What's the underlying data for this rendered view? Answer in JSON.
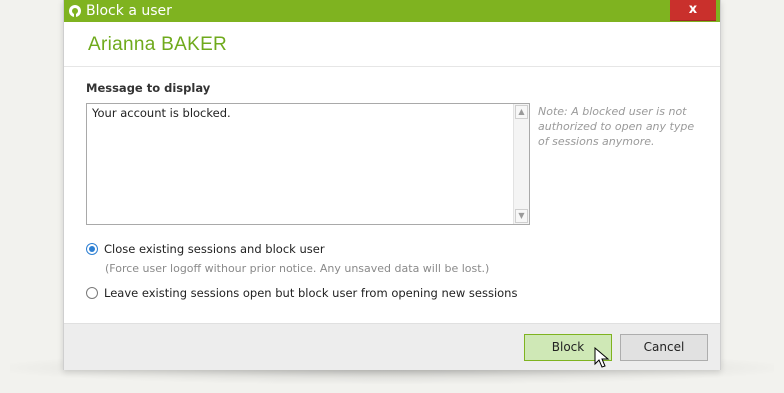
{
  "window": {
    "title": "Block a user",
    "close_label": "x",
    "accent_color": "#7fb320",
    "close_color": "#c9302c"
  },
  "user": {
    "name": "Arianna BAKER"
  },
  "message": {
    "label": "Message to display",
    "value": "Your account is blocked."
  },
  "note": "Note: A blocked user is not authorized to open any type of sessions anymore.",
  "options": [
    {
      "label": "Close existing sessions and block user",
      "checked": true,
      "description": "(Force user logoff withour prior notice. Any unsaved data will be lost.)"
    },
    {
      "label": "Leave existing sessions open but block user from opening new sessions",
      "checked": false
    }
  ],
  "buttons": {
    "block": "Block",
    "cancel": "Cancel"
  }
}
